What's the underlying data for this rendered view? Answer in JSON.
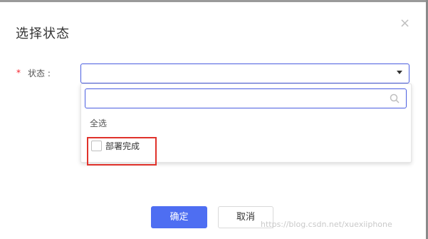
{
  "dialog": {
    "title": "选择状态",
    "close_glyph": "×"
  },
  "form": {
    "required_mark": "*",
    "status_label": "状态 :",
    "select_value": ""
  },
  "dropdown": {
    "search_value": "",
    "select_all_label": "全选",
    "options": [
      {
        "label": "部署完成",
        "checked": false
      }
    ]
  },
  "buttons": {
    "ok": "确定",
    "cancel": "取消"
  },
  "watermark": "https://blog.csdn.net/xuexiiphone",
  "colors": {
    "primary": "#4e6ef2",
    "focus_border": "#4a5ee0",
    "required": "#f5222d",
    "highlight": "#e0322b"
  },
  "icons": [
    "close-icon",
    "chevron-down-icon",
    "search-icon",
    "checkbox-icon"
  ]
}
